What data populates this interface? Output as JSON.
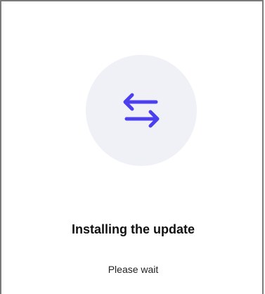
{
  "dialog": {
    "icon": "swap-arrows-icon",
    "accent_color": "#4b3ff0",
    "circle_color": "#f0f1f7",
    "title": "Installing the update",
    "subtitle": "Please wait"
  }
}
